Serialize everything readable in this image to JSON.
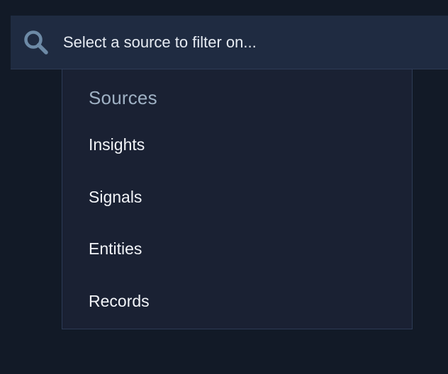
{
  "search": {
    "placeholder": "Select a source to filter on...",
    "icon": "search-icon"
  },
  "dropdown": {
    "group_label": "Sources",
    "options": [
      {
        "label": "Insights"
      },
      {
        "label": "Signals"
      },
      {
        "label": "Entities"
      },
      {
        "label": "Records"
      }
    ]
  },
  "colors": {
    "background": "#121a27",
    "search_bar": "#1f2b41",
    "dropdown": "#1a2133",
    "group_label": "#9fb1c4",
    "option_text": "#f2f4f8",
    "icon": "#6d8aa6"
  }
}
